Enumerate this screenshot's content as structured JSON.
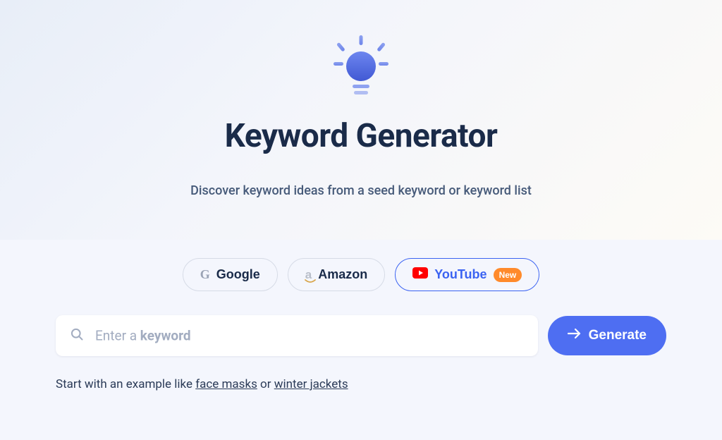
{
  "title": "Keyword Generator",
  "subtitle": "Discover keyword ideas from a seed keyword or keyword list",
  "tabs": [
    {
      "label": "Google",
      "active": false
    },
    {
      "label": "Amazon",
      "active": false
    },
    {
      "label": "YouTube",
      "active": true,
      "badge": "New"
    }
  ],
  "search": {
    "placeholder_prefix": "Enter a ",
    "placeholder_bold": "keyword"
  },
  "generate_label": "Generate",
  "example": {
    "prefix": "Start with an example like ",
    "link1": "face masks",
    "sep": " or ",
    "link2": "winter jackets"
  }
}
